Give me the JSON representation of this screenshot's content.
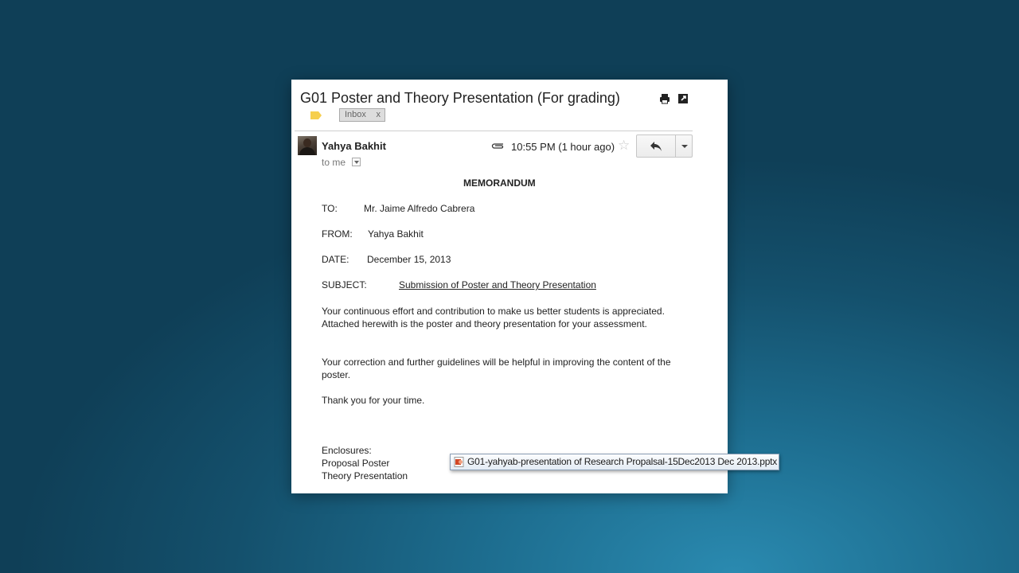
{
  "email": {
    "subject": "G01 Poster and Theory Presentation (For grading)",
    "label_chip": "Inbox",
    "label_chip_close": "x",
    "sender": "Yahya Bakhit",
    "recipient_line": "to me",
    "timestamp": "10:55 PM (1 hour ago)",
    "star_glyph": "☆",
    "icons": {
      "print": "print-icon",
      "new_window": "new-window-icon",
      "label": "label-icon",
      "attachment": "paperclip-icon",
      "reply": "reply-icon",
      "more": "chevron-down-icon"
    }
  },
  "memo": {
    "title": "MEMORANDUM",
    "to_label": "TO:",
    "to_value": "Mr. Jaime Alfredo Cabrera",
    "from_label": "FROM:",
    "from_value": "Yahya Bakhit",
    "date_label": "DATE:",
    "date_value": "December 15, 2013",
    "subject_label": "SUBJECT:",
    "subject_value": "Submission of Poster and Theory Presentation",
    "paragraph1": "Your continuous effort and contribution to make us better students is appreciated. Attached herewith is the poster and theory presentation for your assessment.",
    "paragraph2": "Your correction and further guidelines will be helpful in improving the content of the poster.",
    "paragraph3": "Thank you for your time.",
    "enclosures_label": "Enclosures:",
    "enclosure_1": "Proposal Poster",
    "enclosure_2": "Theory Presentation"
  },
  "tooltip": {
    "text": "G01-yahyab-presentation of Research Propalsal-15Dec2013 Dec 2013.pptx",
    "icon": "powerpoint-file-icon"
  },
  "colors": {
    "label_yellow": "#f6cf4e",
    "tooltip_border": "#8c9fb6",
    "background_teal": "#14506c"
  }
}
